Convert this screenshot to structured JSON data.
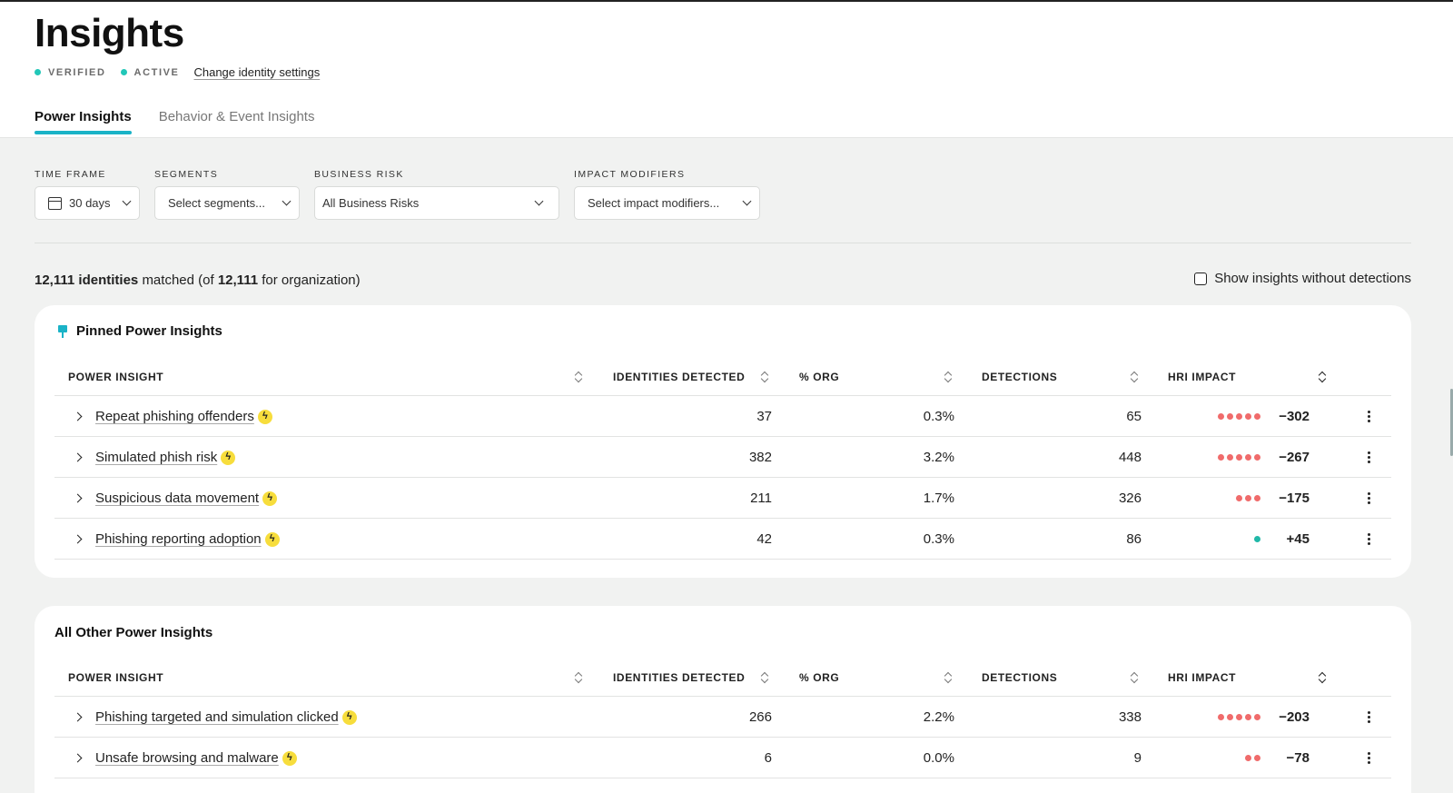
{
  "header": {
    "title": "Insights",
    "status": [
      "VERIFIED",
      "ACTIVE"
    ],
    "change_link": "Change identity settings",
    "tabs": [
      "Power Insights",
      "Behavior & Event Insights"
    ]
  },
  "filters": {
    "time_frame": {
      "label": "TIME FRAME",
      "value": "30 days"
    },
    "segments": {
      "label": "SEGMENTS",
      "value": "Select segments..."
    },
    "business_risk": {
      "label": "BUSINESS RISK",
      "value": "All Business Risks"
    },
    "impact_modifiers": {
      "label": "IMPACT MODIFIERS",
      "value": "Select impact modifiers..."
    }
  },
  "summary": {
    "matched_count": "12,111",
    "matched_label": "identities",
    "matched_word": "matched (of",
    "org_count": "12,111",
    "org_label": "for organization)",
    "show_without": "Show insights without detections"
  },
  "columns": [
    "POWER INSIGHT",
    "IDENTITIES DETECTED",
    "% ORG",
    "DETECTIONS",
    "HRI IMPACT"
  ],
  "pinned": {
    "title": "Pinned Power Insights",
    "rows": [
      {
        "name": "Repeat phishing offenders",
        "identities": "37",
        "org": "0.3%",
        "detections": "65",
        "dots": 5,
        "impact": "−302",
        "positive": false
      },
      {
        "name": "Simulated phish risk",
        "identities": "382",
        "org": "3.2%",
        "detections": "448",
        "dots": 5,
        "impact": "−267",
        "positive": false
      },
      {
        "name": "Suspicious data movement",
        "identities": "211",
        "org": "1.7%",
        "detections": "326",
        "dots": 3,
        "impact": "−175",
        "positive": false
      },
      {
        "name": "Phishing reporting adoption",
        "identities": "42",
        "org": "0.3%",
        "detections": "86",
        "dots": 1,
        "impact": "+45",
        "positive": true
      }
    ]
  },
  "other": {
    "title": "All Other Power Insights",
    "rows": [
      {
        "name": "Phishing targeted and simulation clicked",
        "identities": "266",
        "org": "2.2%",
        "detections": "338",
        "dots": 5,
        "impact": "−203",
        "positive": false
      },
      {
        "name": "Unsafe browsing and malware",
        "identities": "6",
        "org": "0.0%",
        "detections": "9",
        "dots": 2,
        "impact": "−78",
        "positive": false
      }
    ]
  },
  "colors": {
    "accent": "#1ab3c7",
    "verified_dot": "#22c7b8",
    "negative_dot": "#f06b6b",
    "positive_dot": "#21b8a8",
    "bolt": "#f7dd3c"
  }
}
